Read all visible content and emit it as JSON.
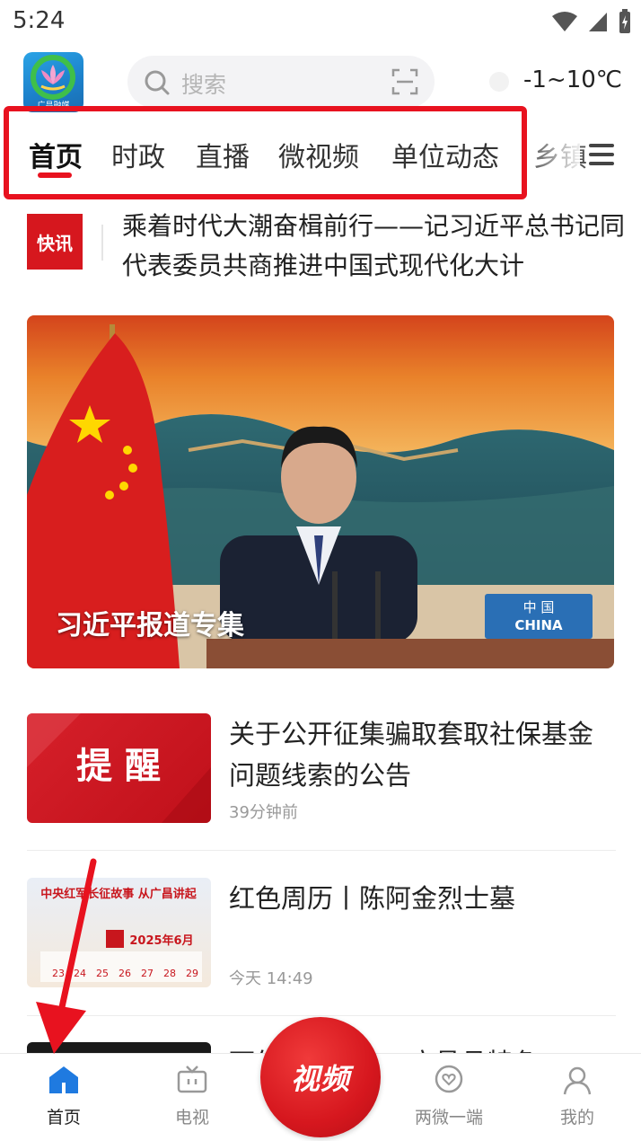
{
  "status_bar": {
    "time": "5:24"
  },
  "header": {
    "logo_text": "广昌融媒",
    "search_placeholder": "搜索",
    "weather": "-1~10℃"
  },
  "tabs": [
    {
      "label": "首页",
      "active": true
    },
    {
      "label": "时政"
    },
    {
      "label": "直播"
    },
    {
      "label": "微视频"
    },
    {
      "label": "单位动态"
    },
    {
      "label": "乡镇"
    }
  ],
  "flash": {
    "badge": "快讯",
    "text": "乘着时代大潮奋楫前行——记习近平总书记同代表委员共商推进中国式现代化大计"
  },
  "banner": {
    "caption": "习近平报道专集",
    "nameplate_cn": "中 国",
    "nameplate_en": "CHINA"
  },
  "news": [
    {
      "title": "关于公开征集骗取套取社保基金问题线索的公告",
      "time": "39分钟前",
      "thumb_text": "提 醒"
    },
    {
      "title": "红色周历丨陈阿金烈士墓",
      "time": "今天 14:49",
      "thumb_title": "中央红军长征故事 从广昌讲起",
      "thumb_date": "2025年6月",
      "thumb_days": [
        "23",
        "24",
        "25",
        "26",
        "27",
        "28",
        "29"
      ]
    },
    {
      "title": "下午...合全！...广昌县特色"
    }
  ],
  "bottom_nav": {
    "items": [
      {
        "label": "首页",
        "icon": "home-icon",
        "active": true
      },
      {
        "label": "电视",
        "icon": "tv-icon"
      },
      {
        "label": "两微一端",
        "icon": "heart-chat-icon"
      },
      {
        "label": "我的",
        "icon": "user-icon"
      }
    ],
    "video_label": "视频"
  },
  "colors": {
    "accent_red": "#e8121f",
    "text_dark": "#222222",
    "text_muted": "#999999"
  }
}
